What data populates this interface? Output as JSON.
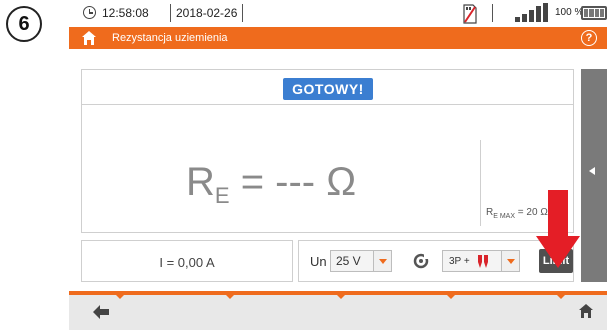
{
  "step_badge": "6",
  "status": {
    "time": "12:58:08",
    "date": "2018-02-26",
    "battery_percent": "100 %",
    "signal_bars": 4,
    "battery_level": 1.0
  },
  "title_bar": {
    "title": "Rezystancja uziemienia",
    "help": "?"
  },
  "measurement": {
    "status": "GOTOWY!",
    "symbol": "R",
    "symbol_sub": "E",
    "value_text": " = --- Ω",
    "limit_symbol": "R",
    "limit_sub": "E MAX",
    "limit_value": " = 20 Ω"
  },
  "current": {
    "text": "I = 0,00 A"
  },
  "settings": {
    "un_label": "Un",
    "un_value": "25 V",
    "method_value": "3P +",
    "limit_button": "Limit"
  },
  "colors": {
    "accent": "#ef6b1d",
    "ready_badge": "#3b7ed1",
    "annotation_arrow": "#e41e26"
  },
  "icons": {
    "clock": "clock-icon",
    "memory": "memory-card-icon",
    "signal": "signal-icon",
    "battery": "battery-icon",
    "home": "home-icon",
    "help": "help-icon",
    "side_toggle": "arrow-left-icon",
    "clamp": "clamp-icon",
    "probe": "probe-icon",
    "back": "back-arrow-icon"
  }
}
